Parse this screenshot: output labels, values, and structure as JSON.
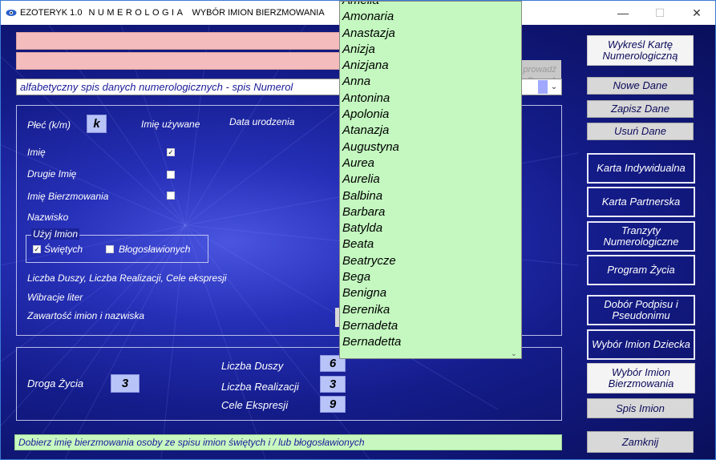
{
  "window": {
    "app": "EZOTERYK 1.0",
    "module": "NUMEROLOGIA",
    "subtitle": "WYBÓR IMION BIERZMOWANIA",
    "minimize_icon": "minimize-icon",
    "maximize_icon": "maximize-icon",
    "close_icon": "close-icon"
  },
  "hidden_button": {
    "line1": "prowadź",
    "line2": "Dane A"
  },
  "combo": {
    "value": "alfabetyczny spis danych numerologicznych - spis Numerol"
  },
  "form": {
    "sex_label": "Płeć (k/m)",
    "sex_value": "k",
    "used_name_label": "Imię używane",
    "birthdate_label": "Data urodzenia",
    "first_name_label": "Imię",
    "second_name_label": "Drugie Imię",
    "confirmation_name_label": "Imię Bierzmowania",
    "surname_label": "Nazwisko",
    "group_legend": "Użyj Imion",
    "saints_label": "Świętych",
    "blessed_label": "Błogosławionych",
    "soul_line": "Liczba Duszy, Liczba Realizacji, Cele ekspresji",
    "letter_vibrations": "Wibracje liter",
    "content_line": "Zawartość imion i nazwiska"
  },
  "checkboxes": {
    "first_name": true,
    "second_name": false,
    "confirmation_name": false,
    "saints": true,
    "blessed": false
  },
  "numbers": {
    "life_path_label": "Droga Życia",
    "life_path_value": "3",
    "soul_label": "Liczba Duszy",
    "soul_value": "6",
    "realization_label": "Liczba Realizacji",
    "realization_value": "3",
    "expression_label": "Cele Ekspresji",
    "expression_value": "9"
  },
  "buttons": {
    "draw_chart": "Wykreśl Kartę Numerologiczną",
    "new_data": "Nowe Dane",
    "save_data": "Zapisz Dane",
    "delete_data": "Usuń Dane",
    "individual_chart": "Karta Indywidualna",
    "partner_chart": "Karta Partnerska",
    "transits": "Tranzyty Numerologiczne",
    "life_program": "Program Życia",
    "signature": "Dobór Podpisu i Pseudonimu",
    "child_names": "Wybór Imion Dziecka",
    "confirmation_names": "Wybór Imion Bierzmowania",
    "name_list": "Spis Imion",
    "close": "Zamknij"
  },
  "status": "Dobierz imię bierzmowania osoby ze spisu imion świętych i / lub błogosławionych",
  "dropdown": {
    "items": [
      "Amelia",
      "Amonaria",
      "Anastazja",
      "Anizja",
      "Anizjana",
      "Anna",
      "Antonina",
      "Apolonia",
      "Atanazja",
      "Augustyna",
      "Aurea",
      "Aurelia",
      "Balbina",
      "Barbara",
      "Batylda",
      "Beata",
      "Beatrycze",
      "Bega",
      "Benigna",
      "Berenika",
      "Bernadeta",
      "Bernadetta"
    ]
  },
  "colors": {
    "background": "#141c8a",
    "list_bg": "#c4f8c0",
    "pink_field": "#f4bcbc",
    "value_box": "#b8c4f8"
  }
}
